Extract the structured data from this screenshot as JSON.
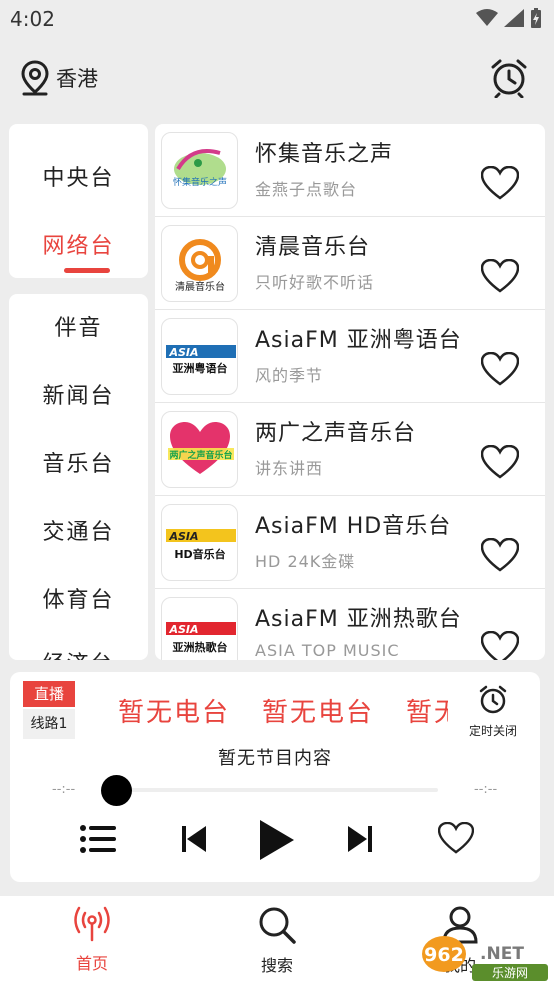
{
  "status_bar": {
    "time": "4:02"
  },
  "header": {
    "location": "香港"
  },
  "categories_top": [
    {
      "label": "中央台",
      "selected": false
    },
    {
      "label": "网络台",
      "selected": true
    }
  ],
  "categories_bottom": [
    {
      "label": "伴音"
    },
    {
      "label": "新闻台"
    },
    {
      "label": "音乐台"
    },
    {
      "label": "交通台"
    },
    {
      "label": "体育台"
    },
    {
      "label": "经济台"
    }
  ],
  "stations": [
    {
      "name": "怀集音乐之声",
      "desc": "金燕子点歌台"
    },
    {
      "name": "清晨音乐台",
      "desc": "只听好歌不听话"
    },
    {
      "name": "AsiaFM 亚洲粤语台",
      "desc": "风的季节"
    },
    {
      "name": "两广之声音乐台",
      "desc": "讲东讲西"
    },
    {
      "name": "AsiaFM HD音乐台",
      "desc": "HD 24K金碟"
    },
    {
      "name": "AsiaFM 亚洲热歌台",
      "desc": "ASIA TOP MUSIC"
    }
  ],
  "logos": {
    "huaiji": {
      "text": "怀集音乐之声"
    },
    "qingchen": {
      "text": "清晨音乐台"
    },
    "asia_yue": {
      "brand": "ASIA",
      "sub": "亚洲粤语台"
    },
    "liangguang": {
      "text": "两广之声音乐台"
    },
    "asia_hd": {
      "brand": "ASIA",
      "sub": "HD音乐台"
    },
    "asia_hot": {
      "brand": "ASIA",
      "sub": "亚洲热歌台"
    }
  },
  "player": {
    "live_label": "直播",
    "line_label": "线路1",
    "now_playing": [
      "暂无电台",
      "暂无电台",
      "暂无电台"
    ],
    "timer_label": "定时关闭",
    "program": "暂无节目内容",
    "time_elapsed": "--:--",
    "time_total": "--:--",
    "progress": 0
  },
  "bottom_nav": [
    {
      "label": "首页",
      "active": true
    },
    {
      "label": "搜索",
      "active": false
    },
    {
      "label": "我的",
      "active": false
    }
  ],
  "watermark": {
    "brand": "962.NET",
    "sub": "乐游网"
  },
  "colors": {
    "accent": "#e8443e",
    "background": "#ededed",
    "card": "#ffffff"
  }
}
